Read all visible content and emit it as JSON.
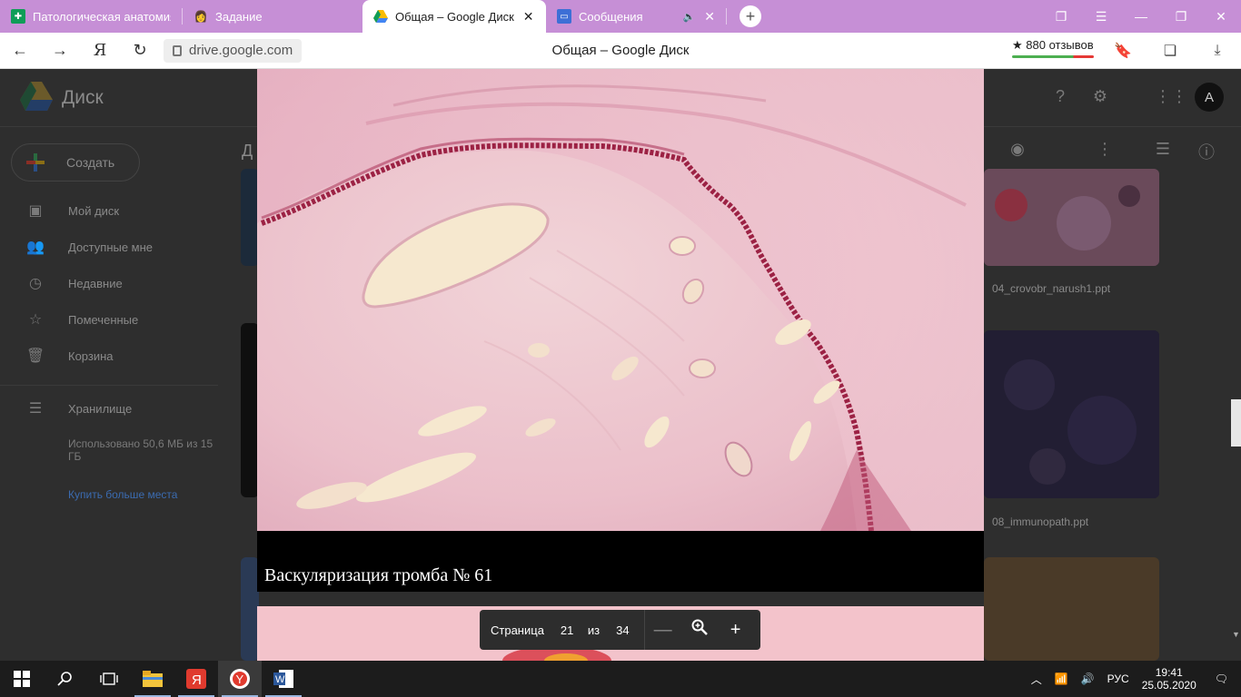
{
  "browser": {
    "tabs": [
      {
        "title": "Патологическая анатомия",
        "active": false
      },
      {
        "title": "Задание",
        "active": false
      },
      {
        "title": "Общая – Google Диск",
        "active": true
      },
      {
        "title": "Сообщения",
        "active": false
      }
    ],
    "url": "drive.google.com",
    "page_title": "Общая – Google Диск",
    "reviews": "★ 880 отзывов",
    "yandex_button": "Я"
  },
  "drive": {
    "app_name": "Диск",
    "create_label": "Создать",
    "breadcrumb": "Д",
    "avatar_letter": "А",
    "sidebar": {
      "items": [
        {
          "label": "Мой диск",
          "icon": "my-drive-icon"
        },
        {
          "label": "Доступные мне",
          "icon": "shared-icon"
        },
        {
          "label": "Недавние",
          "icon": "clock-icon"
        },
        {
          "label": "Помеченные",
          "icon": "star-icon"
        },
        {
          "label": "Корзина",
          "icon": "trash-icon"
        }
      ],
      "storage_label": "Хранилище",
      "storage_text": "Использовано 50,6 МБ из 15 ГБ",
      "buy_more": "Купить больше места"
    },
    "files": [
      {
        "name": "04_crovobr_narush1.ppt"
      },
      {
        "name": "08_immunopath.ppt"
      }
    ]
  },
  "viewer": {
    "slide_caption": "Васкуляризация тромба № 61",
    "page_label": "Страница",
    "current_page": "21",
    "of_label": "из",
    "total_pages": "34"
  },
  "taskbar": {
    "language": "РУС",
    "time": "19:41",
    "date": "25.05.2020"
  },
  "colors": {
    "tabbar": "#c68fd6",
    "tissue_pink": "#e9b6c4",
    "vessel_wall": "#9c2244"
  }
}
